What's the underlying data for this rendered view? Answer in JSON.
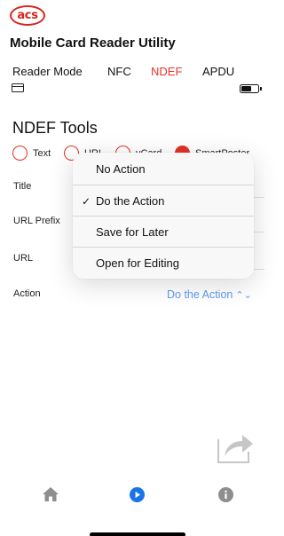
{
  "header": {
    "logo_text": "acs",
    "app_title": "Mobile Card Reader Utility"
  },
  "tabs": [
    {
      "label": "Reader Mode",
      "active": false
    },
    {
      "label": "NFC",
      "active": false
    },
    {
      "label": "NDEF",
      "active": true
    },
    {
      "label": "APDU",
      "active": false
    }
  ],
  "status": {
    "card_icon": "card-icon",
    "battery_icon": "battery-icon"
  },
  "ndef": {
    "section_title": "NDEF Tools",
    "radio_options": [
      {
        "label": "Text",
        "selected": false
      },
      {
        "label": "URI",
        "selected": false
      },
      {
        "label": "vCard",
        "selected": false
      },
      {
        "label": "SmartPoster",
        "selected": true
      }
    ],
    "fields": {
      "title_label": "Title",
      "url_prefix_label": "URL Prefix",
      "url_label": "URL",
      "action_label": "Action",
      "action_value": "Do the Action"
    }
  },
  "action_menu": {
    "items": [
      {
        "label": "No Action",
        "checked": false
      },
      {
        "label": "Do the Action",
        "checked": true
      },
      {
        "label": "Save for Later",
        "checked": false
      },
      {
        "label": "Open for Editing",
        "checked": false
      }
    ],
    "check_mark": "✓"
  },
  "share_icon": "share-icon",
  "tab_bar": [
    "home-icon",
    "play-icon",
    "info-icon"
  ],
  "colors": {
    "accent_red": "#e33126",
    "link_blue": "#5e9bf0",
    "tabbar_blue": "#1a73e8",
    "tabbar_gray": "#8e8e8e"
  }
}
